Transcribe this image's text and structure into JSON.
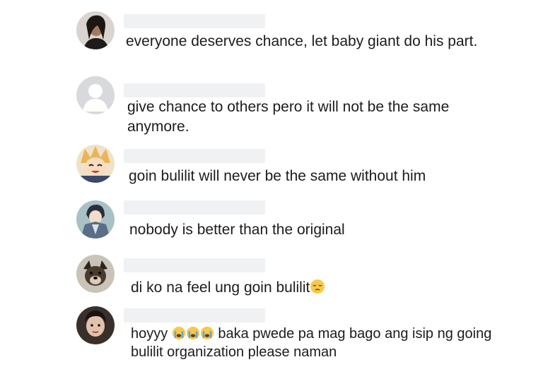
{
  "comments": [
    {
      "text": "everyone deserves chance, let baby giant do his part.",
      "avatar": "woman-portrait-avatar"
    },
    {
      "text": "give chance to others pero it will not be the same anymore.",
      "avatar": "default-user-avatar"
    },
    {
      "text": "goin bulilit will never be the same without him",
      "avatar": "anime-character-avatar"
    },
    {
      "text": "nobody is better than the original",
      "avatar": "anime-knight-avatar"
    },
    {
      "text": "di ko na feel ung goin bulilit",
      "emoji_after": "pensive-face",
      "avatar": "dog-avatar"
    },
    {
      "text_before": "hoyyy",
      "emojis": [
        "loudly-crying-face",
        "loudly-crying-face",
        "loudly-crying-face"
      ],
      "text_after": "baka pwede pa mag bago ang isip ng going bulilit organization please naman",
      "avatar": "person-selfie-avatar"
    }
  ],
  "colors": {
    "text": "#1c1c1e",
    "name_placeholder": "#f0f1f3",
    "emoji": "#f7c94a"
  }
}
